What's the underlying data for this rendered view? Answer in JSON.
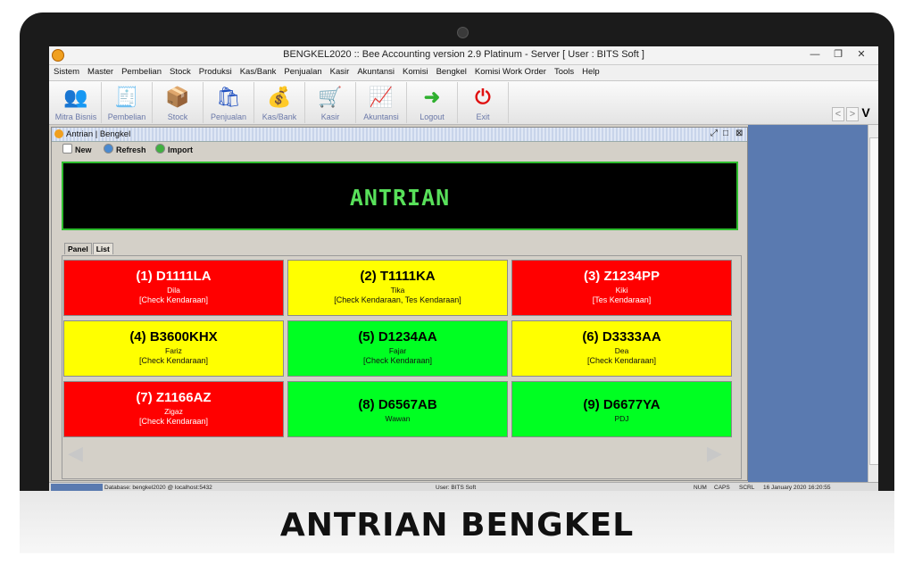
{
  "window": {
    "title": "BENGKEL2020 :: Bee Accounting version 2.9 Platinum - Server  [ User : BITS Soft ]",
    "controls": [
      "—",
      "❐",
      "✕"
    ]
  },
  "menu": [
    "Sistem",
    "Master",
    "Pembelian",
    "Stock",
    "Produksi",
    "Kas/Bank",
    "Penjualan",
    "Kasir",
    "Akuntansi",
    "Komisi",
    "Bengkel",
    "Komisi Work Order",
    "Tools",
    "Help"
  ],
  "toolbar": [
    {
      "label": "Mitra Bisnis",
      "icon": "people-icon"
    },
    {
      "label": "Pembelian",
      "icon": "receipt-icon"
    },
    {
      "label": "Stock",
      "icon": "boxes-icon"
    },
    {
      "label": "Penjualan",
      "icon": "shopping-bag-icon"
    },
    {
      "label": "Kas/Bank",
      "icon": "money-bag-icon"
    },
    {
      "label": "Kasir",
      "icon": "cart-icon"
    },
    {
      "label": "Akuntansi",
      "icon": "chart-up-icon"
    },
    {
      "label": "Logout",
      "icon": "logout-arrow-icon"
    },
    {
      "label": "Exit",
      "icon": "power-icon"
    }
  ],
  "nav": {
    "prev": "<",
    "next": ">",
    "v": "V"
  },
  "inner_window": {
    "title": "Antrian | Bengkel",
    "tools": {
      "new": "New",
      "refresh": "Refresh",
      "import": "Import"
    },
    "banner": "ANTRIAN",
    "tabs": [
      "Panel",
      "List"
    ]
  },
  "queue": [
    {
      "plate": "(1) D1111LA",
      "name": "Dila",
      "service": "[Check Kendaraan]",
      "color": "red"
    },
    {
      "plate": "(2) T1111KA",
      "name": "Tika",
      "service": "[Check Kendaraan, Tes Kendaraan]",
      "color": "yellow"
    },
    {
      "plate": "(3) Z1234PP",
      "name": "Kiki",
      "service": "[Tes Kendaraan]",
      "color": "red"
    },
    {
      "plate": "(4) B3600KHX",
      "name": "Fariz",
      "service": "[Check Kendaraan]",
      "color": "yellow"
    },
    {
      "plate": "(5) D1234AA",
      "name": "Fajar",
      "service": "[Check Kendaraan]",
      "color": "green"
    },
    {
      "plate": "(6) D3333AA",
      "name": "Dea",
      "service": "[Check Kendaraan]",
      "color": "yellow"
    },
    {
      "plate": "(7) Z1166AZ",
      "name": "Zigaz",
      "service": "[Check Kendaraan]",
      "color": "red"
    },
    {
      "plate": "(8) D6567AB",
      "name": "Wawan",
      "service": "",
      "color": "green"
    },
    {
      "plate": "(9) D6677YA",
      "name": "PDJ",
      "service": "",
      "color": "green"
    }
  ],
  "status": {
    "database": "Database: bengkel2020 @ localhost:5432",
    "user": "User: BITS Soft",
    "num": "NUM",
    "caps": "CAPS",
    "scrl": "SCRL",
    "datetime": "16 January 2020  16:20:55"
  },
  "caption": "ANTRIAN BENGKEL"
}
